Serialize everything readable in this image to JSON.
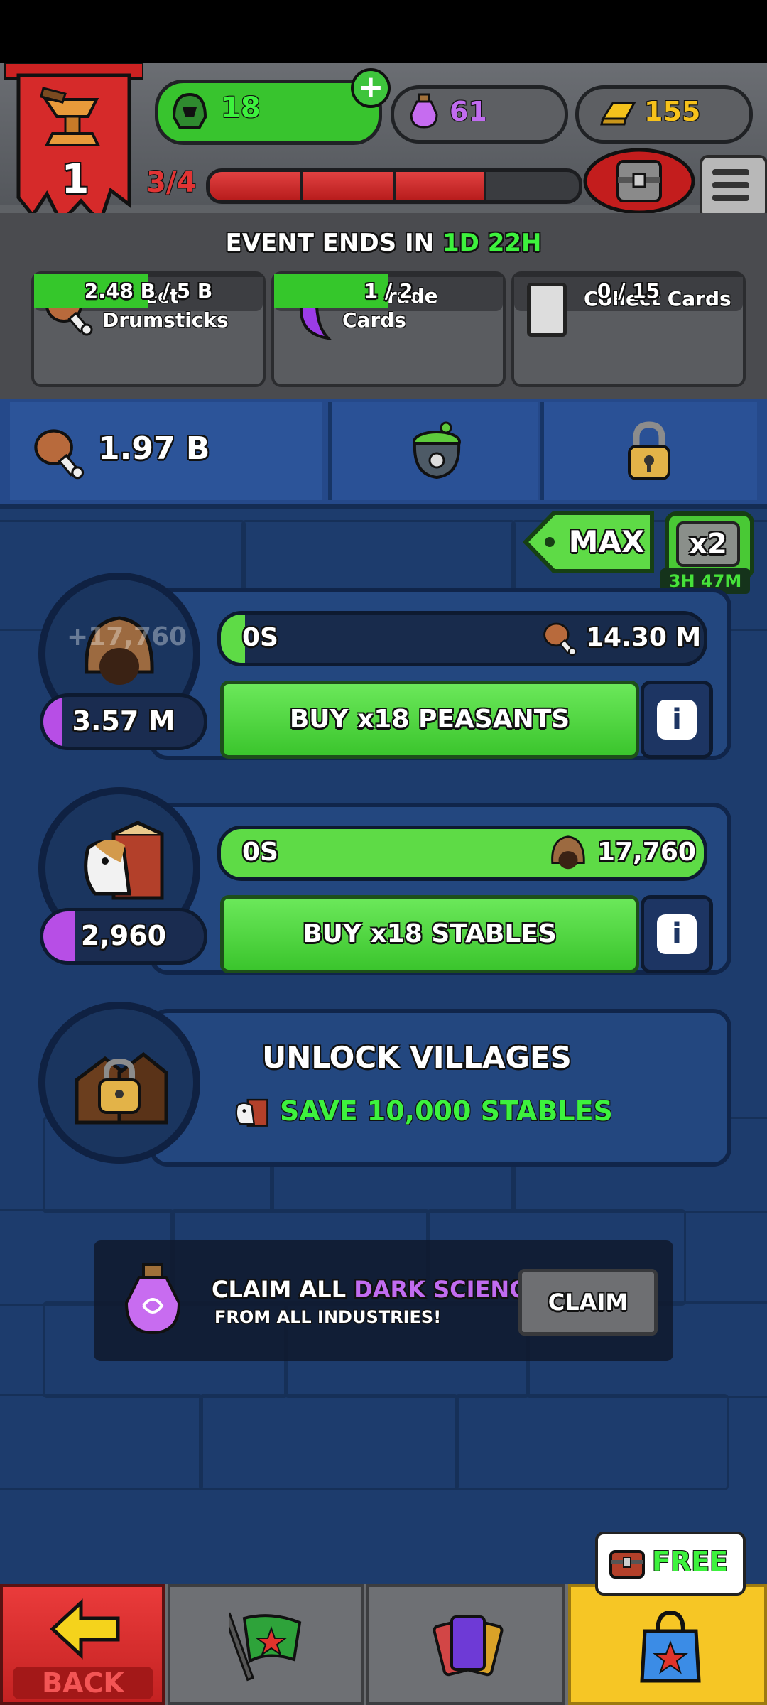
{
  "hud": {
    "level": "1",
    "xp_text": "3/4",
    "xp_fraction": 0.75,
    "green_resource": "18",
    "purple_resource": "61",
    "gold_resource": "155"
  },
  "event": {
    "ends_label": "EVENT ENDS IN",
    "ends_days": "1D",
    "ends_hours": "22H",
    "tasks": [
      {
        "label": "Collect\nDrumsticks",
        "value": "2.48 B / 5 B",
        "progress": 0.496
      },
      {
        "label": "Upgrade\nCards",
        "value": "1 / 2",
        "progress": 0.5
      },
      {
        "label": "Collect Cards",
        "value": "0 / 15",
        "progress": 0
      }
    ]
  },
  "tabs": {
    "drumsticks_amount": "1.97 B"
  },
  "boost": {
    "max_label": "MAX",
    "multiplier": "x2",
    "timer": "3H 47M"
  },
  "industries": [
    {
      "floating_gain": "+17,760",
      "count": "3.57 M",
      "count_fraction": 0.12,
      "time": "0S",
      "cost": "14.30 M",
      "progress": 0.05,
      "buy_label": "BUY x18 PEASANTS"
    },
    {
      "count": "2,960",
      "count_fraction": 0.2,
      "time": "0S",
      "cost": "17,760",
      "progress": 1.0,
      "buy_label": "BUY x18 STABLES"
    }
  ],
  "unlock": {
    "title": "UNLOCK VILLAGES",
    "requirement": "SAVE 10,000 STABLES"
  },
  "claim_banner": {
    "text_prefix": "CLAIM ALL ",
    "text_highlight": "DARK SCIENCE",
    "subtext": "FROM ALL INDUSTRIES!",
    "button": "CLAIM"
  },
  "nav": {
    "back_label": "BACK",
    "free_label": "FREE"
  },
  "colors": {
    "green_text": "#3df23d",
    "purple_text": "#c16cf0",
    "gold_text": "#f7c21b"
  }
}
